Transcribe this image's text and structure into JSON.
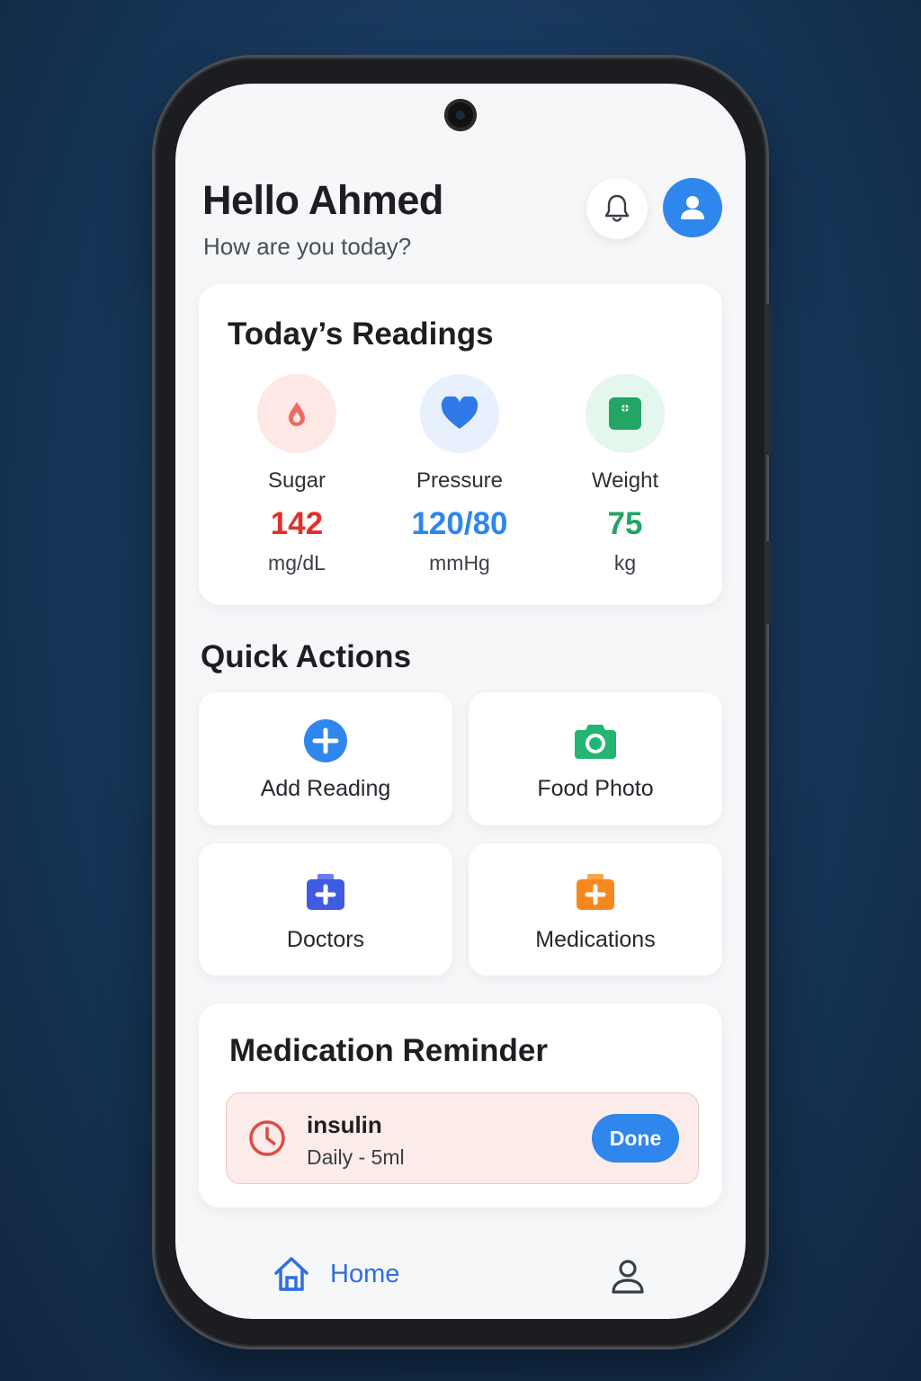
{
  "greeting": {
    "title": "Hello Ahmed",
    "subtitle": "How are you today?"
  },
  "header": {
    "bell_icon": "bell-icon",
    "avatar_icon": "user-icon"
  },
  "readings": {
    "title": "Today’s Readings",
    "items": [
      {
        "label": "Sugar",
        "value": "142",
        "unit": "mg/dL",
        "icon": "blood-drop-icon",
        "color": "#e0312b",
        "bg": "#fde8e6"
      },
      {
        "label": "Pressure",
        "value": "120/80",
        "unit": "mmHg",
        "icon": "heart-icon",
        "color": "#2f86ec",
        "bg": "#e8f0fd"
      },
      {
        "label": "Weight",
        "value": "75",
        "unit": "kg",
        "icon": "scale-icon",
        "color": "#22a565",
        "bg": "#e4f7ec"
      }
    ]
  },
  "quick_actions": {
    "title": "Quick Actions",
    "items": [
      {
        "label": "Add Reading",
        "icon": "plus-circle-icon",
        "color": "#2f86ec"
      },
      {
        "label": "Food Photo",
        "icon": "camera-icon",
        "color": "#22b573"
      },
      {
        "label": "Doctors",
        "icon": "medical-kit-icon",
        "color": "#3f5be0"
      },
      {
        "label": "Medications",
        "icon": "medicine-box-icon",
        "color": "#f5891f"
      }
    ]
  },
  "reminder": {
    "title": "Medication Reminder",
    "name": "insulin",
    "dose": "Daily - 5ml",
    "done_label": "Done",
    "icon": "clock-icon"
  },
  "nav": {
    "home_label": "Home",
    "home_icon": "home-icon",
    "profile_icon": "profile-icon",
    "active_color": "#2f6ee0"
  }
}
